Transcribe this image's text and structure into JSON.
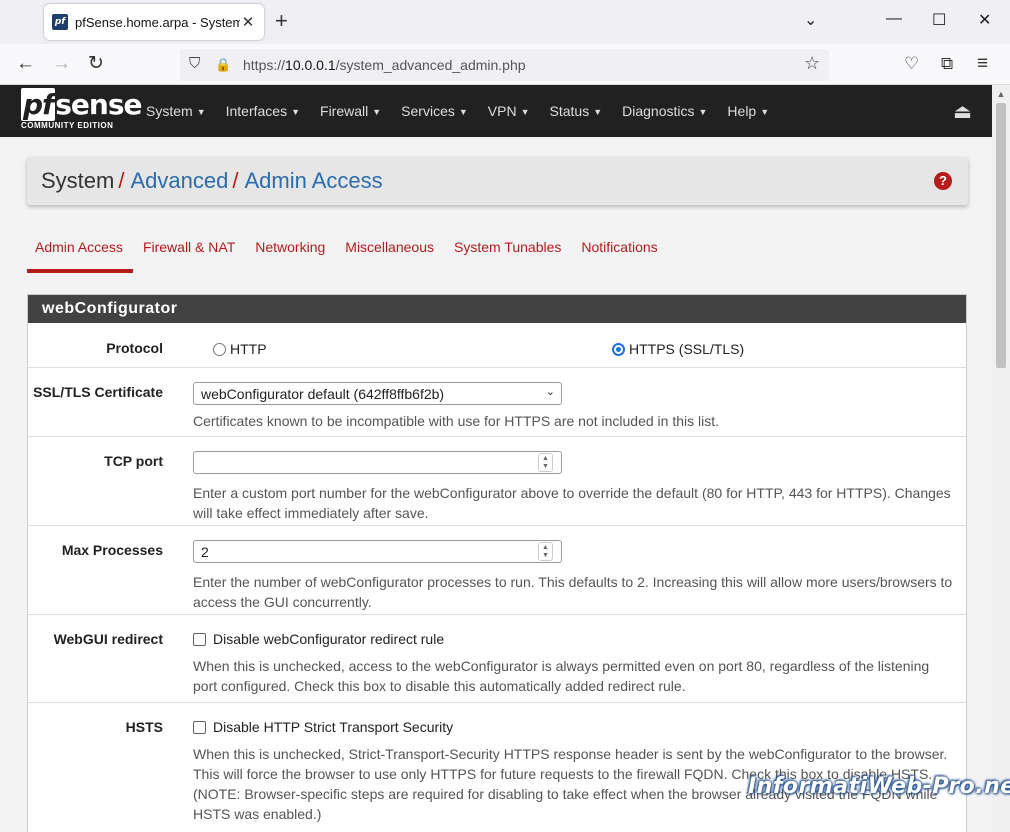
{
  "browser": {
    "tab_title": "pfSense.home.arpa - System: Ad",
    "tab_favicon": "pf",
    "new_tab": "+",
    "url_prefix": "https://",
    "url_host": "10.0.0.1",
    "url_path": "/system_advanced_admin.php",
    "icons": {
      "back": "←",
      "forward": "→",
      "reload": "↻",
      "shield": "⛉",
      "lock": "🔒",
      "star": "☆",
      "pocket": "♡",
      "extensions": "⧉",
      "menu": "≡",
      "minimize": "—",
      "maximize": "☐",
      "close": "✕",
      "tab_close": "✕",
      "chevron": "⌄"
    }
  },
  "pfsense": {
    "logo_main_pf": "pf",
    "logo_main_rest": "sense",
    "logo_sub": "COMMUNITY EDITION",
    "menu": [
      "System",
      "Interfaces",
      "Firewall",
      "Services",
      "VPN",
      "Status",
      "Diagnostics",
      "Help"
    ],
    "caret": "▼",
    "logout_icon": "⏏"
  },
  "breadcrumb": {
    "root": "System",
    "sep": "/",
    "level2": "Advanced",
    "level3": "Admin Access",
    "help_icon": "?"
  },
  "tabs": [
    {
      "label": "Admin Access",
      "active": true
    },
    {
      "label": "Firewall & NAT",
      "active": false
    },
    {
      "label": "Networking",
      "active": false
    },
    {
      "label": "Miscellaneous",
      "active": false
    },
    {
      "label": "System Tunables",
      "active": false
    },
    {
      "label": "Notifications",
      "active": false
    }
  ],
  "panel": {
    "title": "webConfigurator",
    "protocol": {
      "label": "Protocol",
      "option_http": "HTTP",
      "option_https": "HTTPS (SSL/TLS)",
      "selected": "HTTPS (SSL/TLS)"
    },
    "ssl_cert": {
      "label": "SSL/TLS Certificate",
      "value": "webConfigurator default (642ff8ffb6f2b)",
      "help": "Certificates known to be incompatible with use for HTTPS are not included in this list."
    },
    "tcp_port": {
      "label": "TCP port",
      "value": "",
      "help": "Enter a custom port number for the webConfigurator above to override the default (80 for HTTP, 443 for HTTPS). Changes will take effect immediately after save."
    },
    "max_processes": {
      "label": "Max Processes",
      "value": "2",
      "help": "Enter the number of webConfigurator processes to run. This defaults to 2. Increasing this will allow more users/browsers to access the GUI concurrently."
    },
    "webgui_redirect": {
      "label": "WebGUI redirect",
      "checkbox_label": "Disable webConfigurator redirect rule",
      "checked": false,
      "help": "When this is unchecked, access to the webConfigurator is always permitted even on port 80, regardless of the listening port configured. Check this box to disable this automatically added redirect rule."
    },
    "hsts": {
      "label": "HSTS",
      "checkbox_label": "Disable HTTP Strict Transport Security",
      "checked": false,
      "help": "When this is unchecked, Strict-Transport-Security HTTPS response header is sent by the webConfigurator to the browser. This will force the browser to use only HTTPS for future requests to the firewall FQDN. Check this box to disable HSTS. (NOTE: Browser-specific steps are required for disabling to take effect when the browser already visited the FQDN while HSTS was enabled.)"
    }
  },
  "watermark": "InformatiWeb-Pro.net"
}
